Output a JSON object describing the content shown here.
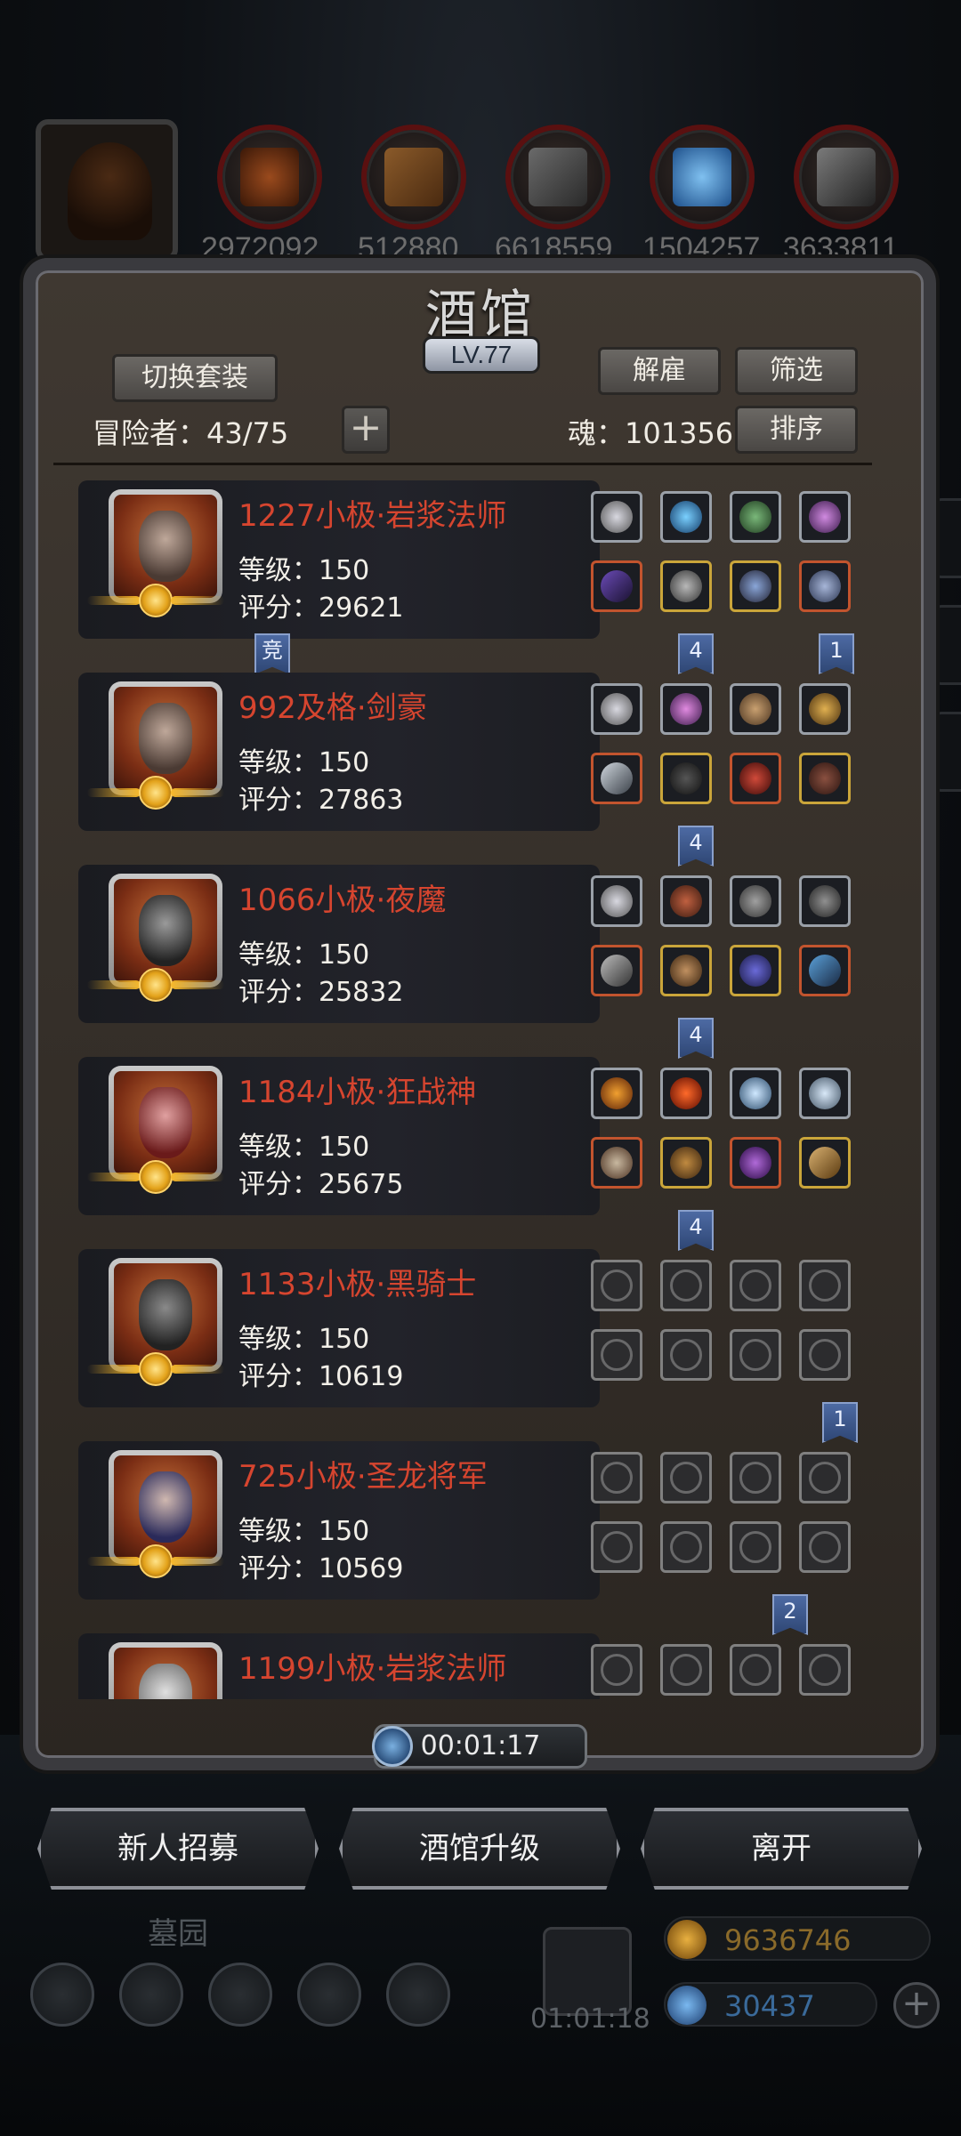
{
  "resources": {
    "values": [
      "2972092",
      "512880",
      "6618559",
      "1504257",
      "3633811"
    ],
    "icons": [
      "chest-icon",
      "wood-icon",
      "stone-icon",
      "crystal-icon",
      "iron-icon"
    ]
  },
  "tavern": {
    "title": "酒馆",
    "level": "LV.77",
    "switch_outfit_label": "切换套装",
    "dismiss_label": "解雇",
    "filter_label": "筛选",
    "sort_label": "排序",
    "adventurers_text": "冒险者：43/75",
    "soul_text": "魂：101356"
  },
  "heroes": [
    {
      "name": "1227小极·岩浆法师",
      "level": "等级：150",
      "score": "评分：29621",
      "gear": "full",
      "flags": [
        "竞",
        "4",
        "1"
      ]
    },
    {
      "name": "992及格·剑豪",
      "level": "等级：150",
      "score": "评分：27863",
      "gear": "full",
      "flags": [
        "4"
      ]
    },
    {
      "name": "1066小极·夜魔",
      "level": "等级：150",
      "score": "评分：25832",
      "gear": "full",
      "flags": [
        "4"
      ]
    },
    {
      "name": "1184小极·狂战神",
      "level": "等级：150",
      "score": "评分：25675",
      "gear": "full",
      "flags": [
        "4"
      ]
    },
    {
      "name": "1133小极·黑骑士",
      "level": "等级：150",
      "score": "评分：10619",
      "gear": "empty",
      "flags": [
        "1"
      ]
    },
    {
      "name": "725小极·圣龙将军",
      "level": "等级：150",
      "score": "评分：10569",
      "gear": "empty",
      "flags": [
        "2"
      ]
    },
    {
      "name": "1199小极·岩浆法师",
      "level": "",
      "score": "",
      "gear": "empty",
      "flags": []
    }
  ],
  "timer": "00:01:17",
  "actions": {
    "recruit_label": "新人招募",
    "upgrade_label": "酒馆升级",
    "leave_label": "离开"
  },
  "dock": {
    "label": "墓园",
    "gift_timer": "01:01:18",
    "gold": "9636746",
    "gems": "30437",
    "plus": "+"
  },
  "colors": {
    "hero_name": "#d6452f",
    "accent_red": "#5a1010",
    "flag_blue": "#2f4775"
  }
}
